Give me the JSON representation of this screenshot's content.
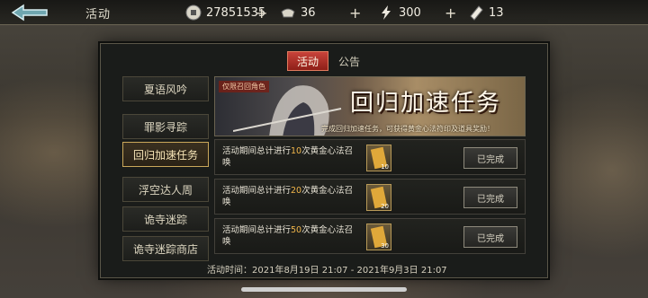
{
  "header": {
    "title": "活动",
    "resources": [
      {
        "name": "coin",
        "icon": "coin-icon",
        "value": "27851535"
      },
      {
        "name": "ingot",
        "icon": "ingot-icon",
        "value": "36"
      },
      {
        "name": "stamina",
        "icon": "lightning-icon",
        "value": "300"
      },
      {
        "name": "ticket",
        "icon": "ticket-icon",
        "value": "13"
      }
    ],
    "plus_symbol": "+"
  },
  "tabs": [
    {
      "label": "活动",
      "active": true
    },
    {
      "label": "公告",
      "active": false
    }
  ],
  "sidebar": {
    "items": [
      {
        "label": "夏语风吟"
      },
      {
        "label": "罪影寻踪"
      },
      {
        "label": "回归加速任务",
        "active": true
      },
      {
        "label": "浮空达人周"
      },
      {
        "label": "诡寺迷踪"
      },
      {
        "label": "诡寺迷踪商店"
      }
    ]
  },
  "banner": {
    "tag": "仅限召回角色",
    "title": "回归加速任务",
    "desc": "完成回归加速任务，可获得黄金心法符印及道具奖励！"
  },
  "tasks": [
    {
      "text_prefix": "活动期间总计进行",
      "count": "10",
      "text_suffix": "次黄金心法召唤",
      "reward_count": "10",
      "status": "已完成"
    },
    {
      "text_prefix": "活动期间总计进行",
      "count": "20",
      "text_suffix": "次黄金心法召唤",
      "reward_count": "20",
      "status": "已完成"
    },
    {
      "text_prefix": "活动期间总计进行",
      "count": "50",
      "text_suffix": "次黄金心法召唤",
      "reward_count": "30",
      "status": "已完成"
    }
  ],
  "footer": {
    "label": "活动时间：",
    "range": "2021年8月19日 21:07 - 2021年9月3日 21:07"
  },
  "colors": {
    "accent_red": "#c8433a",
    "highlight": "#f0b54a",
    "gold_border": "#c9a75a"
  }
}
